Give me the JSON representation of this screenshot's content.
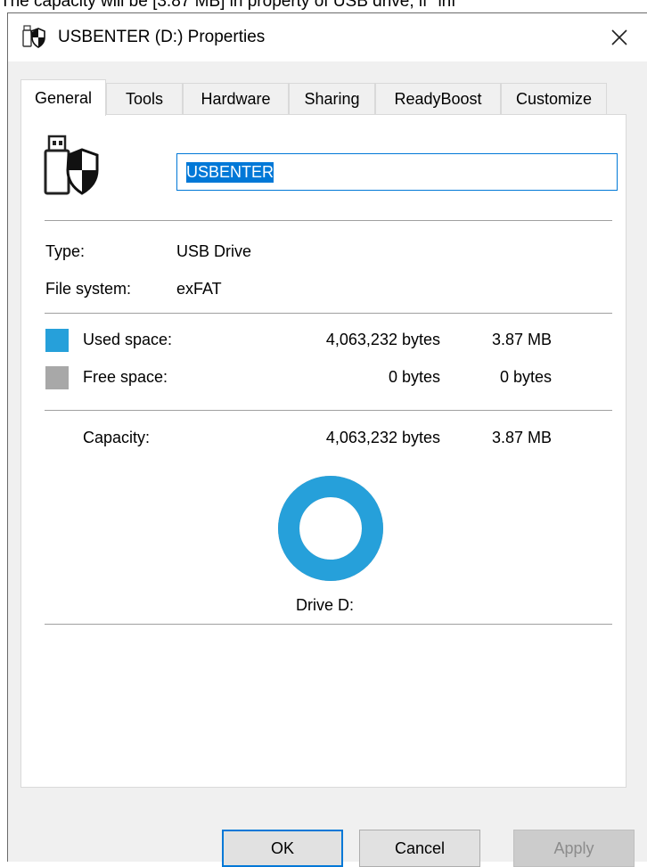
{
  "caption": "The capacity will be [3.87 MB] in property of USB drive, if \"inf",
  "window": {
    "title": "USBENTER (D:) Properties",
    "close_symbol": "✕"
  },
  "tabs": [
    {
      "label": "General",
      "active": true
    },
    {
      "label": "Tools",
      "active": false
    },
    {
      "label": "Hardware",
      "active": false
    },
    {
      "label": "Sharing",
      "active": false
    },
    {
      "label": "ReadyBoost",
      "active": false
    },
    {
      "label": "Customize",
      "active": false
    }
  ],
  "general": {
    "drive_name": "USBENTER",
    "type_label": "Type:",
    "type_value": "USB Drive",
    "fs_label": "File system:",
    "fs_value": "exFAT",
    "used_label": "Used space:",
    "used_bytes": "4,063,232 bytes",
    "used_size": "3.87 MB",
    "free_label": "Free space:",
    "free_bytes": "0 bytes",
    "free_size": "0 bytes",
    "capacity_label": "Capacity:",
    "capacity_bytes": "4,063,232 bytes",
    "capacity_size": "3.87 MB",
    "used_fraction": 1.0,
    "drive_label": "Drive D:"
  },
  "colors": {
    "used": "#26a0da",
    "free": "#a8a8a8",
    "accent": "#0078d7"
  },
  "buttons": {
    "ok": "OK",
    "cancel": "Cancel",
    "apply": "Apply"
  }
}
